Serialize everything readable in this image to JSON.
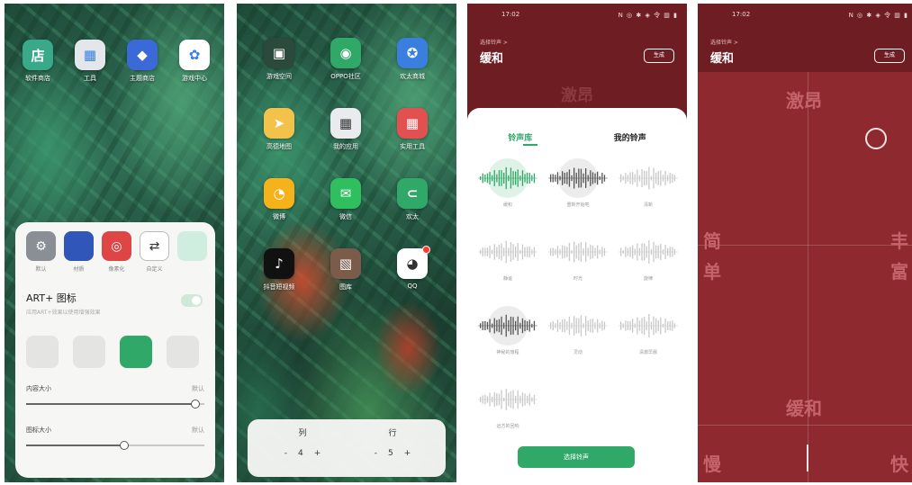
{
  "phone1": {
    "apps": [
      {
        "label": "软件商店",
        "color": "#3aa98a",
        "glyph": "店"
      },
      {
        "label": "工具",
        "color": "#e3e6ea",
        "glyph": "▦"
      },
      {
        "label": "主题商店",
        "color": "#3b6ad8",
        "glyph": "◆"
      },
      {
        "label": "游戏中心",
        "color": "#ffffff",
        "glyph": "✿"
      }
    ],
    "panel_icons": [
      {
        "label": "默认",
        "color": "#8a8f96",
        "glyph": "⚙"
      },
      {
        "label": "材质",
        "color": "#2f56b8",
        "glyph": ""
      },
      {
        "label": "像素化",
        "color": "#e04545",
        "glyph": "◎"
      },
      {
        "label": "自定义",
        "color": "#ffffff",
        "glyph": "⇄"
      },
      {
        "label": "",
        "color": "#cfeee0",
        "glyph": ""
      }
    ],
    "art_title": "ART+ 图标",
    "art_subtitle": "应用ART+效果以使用增强效果",
    "content_size_label": "内容大小",
    "content_size_value": "默认",
    "icon_size_label": "图标大小",
    "icon_size_value": "默认",
    "content_size_fraction": 0.95,
    "icon_size_fraction": 0.55
  },
  "phone2": {
    "apps": [
      {
        "label": "游戏空间",
        "color": "#2b4a3c",
        "glyph": "▣"
      },
      {
        "label": "OPPO社区",
        "color": "#2fa868",
        "glyph": "◉"
      },
      {
        "label": "欢太商城",
        "color": "#3a7ee0",
        "glyph": "✪"
      },
      {
        "label": "高德地图",
        "color": "#f3c24a",
        "glyph": "➤"
      },
      {
        "label": "我的应用",
        "color": "#e9ebee",
        "glyph": "▦"
      },
      {
        "label": "实用工具",
        "color": "#e25050",
        "glyph": "▦"
      },
      {
        "label": "微博",
        "color": "#f5b21b",
        "glyph": "◔"
      },
      {
        "label": "微信",
        "color": "#2fbf5f",
        "glyph": "✉"
      },
      {
        "label": "欢太",
        "color": "#2fa868",
        "glyph": "⊂"
      },
      {
        "label": "抖音短视频",
        "color": "#111111",
        "glyph": "♪"
      },
      {
        "label": "图库",
        "color": "#7b5b4a",
        "glyph": "▧"
      },
      {
        "label": "QQ",
        "color": "#ffffff",
        "glyph": "◕"
      }
    ],
    "grid_label_1": "列",
    "grid_label_2": "行",
    "grid_value_1": "4",
    "grid_value_2": "5",
    "minus": "-",
    "plus": "+"
  },
  "phone3": {
    "time": "17:02",
    "status_icons": "N ◎ ✱ ◈ 令 ▥ ▮",
    "breadcrumb": "选择铃声 >",
    "title": "缓和",
    "generate": "生成",
    "background_word": "激昂",
    "tabs": [
      "铃声库",
      "我的铃声"
    ],
    "waves": [
      {
        "label": "缓和",
        "active": true
      },
      {
        "label": "重新开始吧",
        "active": false,
        "dark": true
      },
      {
        "label": "清新",
        "active": false
      },
      {
        "label": "静谧",
        "active": false
      },
      {
        "label": "时光",
        "active": false
      },
      {
        "label": "旋律",
        "active": false
      },
      {
        "label": "神秘的旅程",
        "active": false,
        "dark": true
      },
      {
        "label": "灵动",
        "active": false
      },
      {
        "label": "清澈早晨",
        "active": false
      },
      {
        "label": "远方的回响",
        "active": false
      }
    ],
    "choose_button": "选择铃声"
  },
  "phone4": {
    "time": "17:02",
    "status_icons": "N ◎ ✱ ◈ 令 ▥ ▮",
    "breadcrumb": "选择铃声 >",
    "title": "缓和",
    "generate": "生成",
    "top_word": "激昂",
    "left_word_1": "简",
    "left_word_2": "单",
    "right_word_1": "丰",
    "right_word_2": "富",
    "bottom_word": "缓和",
    "slow": "慢",
    "fast": "快"
  }
}
